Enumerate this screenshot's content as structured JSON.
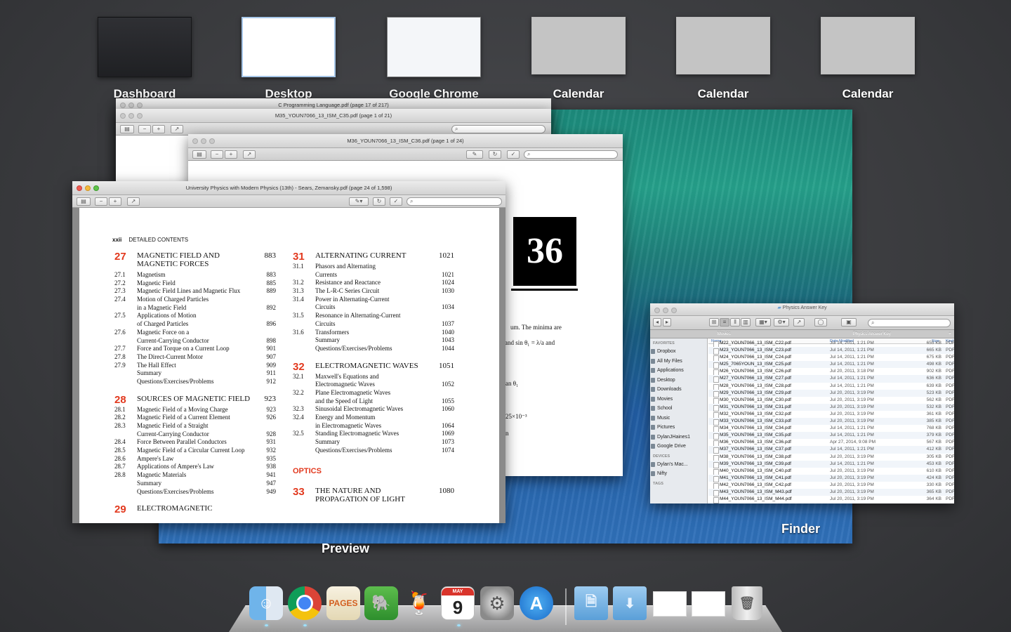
{
  "spaces": [
    {
      "label": "Dashboard"
    },
    {
      "label": "Desktop"
    },
    {
      "label": "Google Chrome"
    },
    {
      "label": "Calendar"
    },
    {
      "label": "Calendar"
    },
    {
      "label": "Calendar"
    }
  ],
  "preview": {
    "app_label": "Preview",
    "windows": {
      "cprog_title": "C Programming Language.pdf (page 17 of 217)",
      "m35_title": "M35_YOUN7066_13_ISM_C35.pdf (page 1 of 21)",
      "m36_title": "M36_YOUN7066_13_ISM_C36.pdf (page 1 of 24)",
      "physics_title": "University Physics with Modern Physics (13th) - Sears, Zemansky.pdf (page 24 of 1,598)"
    },
    "m36_page": {
      "chapter_number": "36",
      "fragments": [
        "um. The minima are",
        "and  sin θ₁ = λ/a  and",
        "an θ₁",
        "25×10⁻³",
        "n"
      ]
    },
    "page": {
      "page_num": "xxii",
      "header": "DETAILED CONTENTS",
      "left_column": [
        {
          "num": "27",
          "title": "MAGNETIC FIELD AND MAGNETIC FORCES",
          "page": "883",
          "sections": [
            {
              "num": "27.1",
              "title": "Magnetism",
              "page": "883"
            },
            {
              "num": "27.2",
              "title": "Magnetic Field",
              "page": "885"
            },
            {
              "num": "27.3",
              "title": "Magnetic Field Lines and Magnetic Flux",
              "page": "889"
            },
            {
              "num": "27.4",
              "title": "Motion of Charged Particles",
              "page": ""
            },
            {
              "num": "",
              "title": "in a Magnetic Field",
              "page": "892"
            },
            {
              "num": "27.5",
              "title": "Applications of Motion",
              "page": ""
            },
            {
              "num": "",
              "title": "of Charged Particles",
              "page": "896"
            },
            {
              "num": "27.6",
              "title": "Magnetic Force on a",
              "page": ""
            },
            {
              "num": "",
              "title": "Current-Carrying Conductor",
              "page": "898"
            },
            {
              "num": "27.7",
              "title": "Force and Torque on a Current Loop",
              "page": "901"
            },
            {
              "num": "27.8",
              "title": "The Direct-Current Motor",
              "page": "907"
            },
            {
              "num": "27.9",
              "title": "The Hall Effect",
              "page": "909"
            },
            {
              "num": "",
              "title": "Summary",
              "page": "911"
            },
            {
              "num": "",
              "title": "Questions/Exercises/Problems",
              "page": "912"
            }
          ]
        },
        {
          "num": "28",
          "title": "SOURCES OF MAGNETIC FIELD",
          "page": "923",
          "sections": [
            {
              "num": "28.1",
              "title": "Magnetic Field of a Moving Charge",
              "page": "923"
            },
            {
              "num": "28.2",
              "title": "Magnetic Field of a Current Element",
              "page": "926"
            },
            {
              "num": "28.3",
              "title": "Magnetic Field of a Straight",
              "page": ""
            },
            {
              "num": "",
              "title": "Current-Carrying Conductor",
              "page": "928"
            },
            {
              "num": "28.4",
              "title": "Force Between Parallel Conductors",
              "page": "931"
            },
            {
              "num": "28.5",
              "title": "Magnetic Field of a Circular Current Loop",
              "page": "932"
            },
            {
              "num": "28.6",
              "title": "Ampere's Law",
              "page": "935"
            },
            {
              "num": "28.7",
              "title": "Applications of Ampere's Law",
              "page": "938"
            },
            {
              "num": "28.8",
              "title": "Magnetic Materials",
              "page": "941"
            },
            {
              "num": "",
              "title": "Summary",
              "page": "947"
            },
            {
              "num": "",
              "title": "Questions/Exercises/Problems",
              "page": "949"
            }
          ]
        },
        {
          "num": "29",
          "title": "ELECTROMAGNETIC",
          "page": "",
          "sections": []
        }
      ],
      "right_column": [
        {
          "num": "31",
          "title": "ALTERNATING CURRENT",
          "page": "1021",
          "sections": [
            {
              "num": "31.1",
              "title": "Phasors and Alternating",
              "page": ""
            },
            {
              "num": "",
              "title": "Currents",
              "page": "1021"
            },
            {
              "num": "31.2",
              "title": "Resistance and Reactance",
              "page": "1024"
            },
            {
              "num": "31.3",
              "title": "The L-R-C Series Circuit",
              "page": "1030"
            },
            {
              "num": "31.4",
              "title": "Power in Alternating-Current",
              "page": ""
            },
            {
              "num": "",
              "title": "Circuits",
              "page": "1034"
            },
            {
              "num": "31.5",
              "title": "Resonance in Alternating-Current",
              "page": ""
            },
            {
              "num": "",
              "title": "Circuits",
              "page": "1037"
            },
            {
              "num": "31.6",
              "title": "Transformers",
              "page": "1040"
            },
            {
              "num": "",
              "title": "Summary",
              "page": "1043"
            },
            {
              "num": "",
              "title": "Questions/Exercises/Problems",
              "page": "1044"
            }
          ]
        },
        {
          "num": "32",
          "title": "ELECTROMAGNETIC WAVES",
          "page": "1051",
          "sections": [
            {
              "num": "32.1",
              "title": "Maxwell's Equations and",
              "page": ""
            },
            {
              "num": "",
              "title": "Electromagnetic Waves",
              "page": "1052"
            },
            {
              "num": "32.2",
              "title": "Plane Electromagnetic Waves",
              "page": ""
            },
            {
              "num": "",
              "title": "and the Speed of Light",
              "page": "1055"
            },
            {
              "num": "32.3",
              "title": "Sinusoidal Electromagnetic Waves",
              "page": "1060"
            },
            {
              "num": "32.4",
              "title": "Energy and Momentum",
              "page": ""
            },
            {
              "num": "",
              "title": "in Electromagnetic Waves",
              "page": "1064"
            },
            {
              "num": "32.5",
              "title": "Standing Electromagnetic Waves",
              "page": "1069"
            },
            {
              "num": "",
              "title": "Summary",
              "page": "1073"
            },
            {
              "num": "",
              "title": "Questions/Exercises/Problems",
              "page": "1074"
            }
          ]
        }
      ],
      "optics_label": "OPTICS",
      "chapter_33": {
        "num": "33",
        "title": "THE NATURE AND PROPAGATION OF LIGHT",
        "page": "1080"
      }
    }
  },
  "finder": {
    "app_label": "Finder",
    "window_title": "Physics Answer Key",
    "tabs": [
      "Movies",
      "Physics Answer Key"
    ],
    "sidebar": {
      "favorites_heading": "FAVORITES",
      "favorites": [
        "Dropbox",
        "All My Files",
        "Applications",
        "Desktop",
        "Downloads",
        "Movies",
        "School",
        "Music",
        "Pictures",
        "DylanJHaines1",
        "Google Drive"
      ],
      "devices_heading": "DEVICES",
      "devices": [
        "Dylan's Mac...",
        "Nifty"
      ],
      "tags_heading": "TAGS"
    },
    "columns": {
      "name": "Name",
      "date": "Date Modified",
      "size": "Size",
      "kind": "Kind"
    },
    "files": [
      {
        "name": "M22_YOUN7066_13_ISM_C22.pdf",
        "date": "Jul 14, 2011, 1:21 PM",
        "size": "655 KB",
        "kind": "PDF Do"
      },
      {
        "name": "M23_YOUN7066_13_ISM_C23.pdf",
        "date": "Jul 14, 2011, 1:21 PM",
        "size": "665 KB",
        "kind": "PDF Do"
      },
      {
        "name": "M24_YOUN7066_13_ISM_C24.pdf",
        "date": "Jul 14, 2011, 1:21 PM",
        "size": "675 KB",
        "kind": "PDF Do"
      },
      {
        "name": "M25_7065YOUN_13_ISM_C25.pdf",
        "date": "Jul 14, 2011, 1:21 PM",
        "size": "498 KB",
        "kind": "PDF Do"
      },
      {
        "name": "M26_YOUN7066_13_ISM_C26.pdf",
        "date": "Jul 20, 2011, 3:18 PM",
        "size": "902 KB",
        "kind": "PDF Do"
      },
      {
        "name": "M27_YOUN7066_13_ISM_C27.pdf",
        "date": "Jul 14, 2011, 1:21 PM",
        "size": "636 KB",
        "kind": "PDF Do"
      },
      {
        "name": "M28_YOUN7066_13_ISM_C28.pdf",
        "date": "Jul 14, 2011, 1:21 PM",
        "size": "639 KB",
        "kind": "PDF Do"
      },
      {
        "name": "M29_YOUN7066_13_ISM_C29.pdf",
        "date": "Jul 20, 2011, 3:19 PM",
        "size": "523 KB",
        "kind": "PDF Do"
      },
      {
        "name": "M30_YOUN7066_13_ISM_C30.pdf",
        "date": "Jul 20, 2011, 3:19 PM",
        "size": "562 KB",
        "kind": "PDF Do"
      },
      {
        "name": "M31_YOUN7066_13_ISM_C31.pdf",
        "date": "Jul 20, 2011, 3:19 PM",
        "size": "532 KB",
        "kind": "PDF Do"
      },
      {
        "name": "M32_YOUN7066_13_ISM_C32.pdf",
        "date": "Jul 20, 2011, 3:19 PM",
        "size": "361 KB",
        "kind": "PDF Do"
      },
      {
        "name": "M33_YOUN7066_13_ISM_C33.pdf",
        "date": "Jul 20, 2011, 3:19 PM",
        "size": "385 KB",
        "kind": "PDF Do"
      },
      {
        "name": "M34_YOUN7066_13_ISM_C34.pdf",
        "date": "Jul 14, 2011, 1:21 PM",
        "size": "768 KB",
        "kind": "PDF Do"
      },
      {
        "name": "M35_YOUN7066_13_ISM_C35.pdf",
        "date": "Jul 14, 2011, 1:21 PM",
        "size": "379 KB",
        "kind": "PDF Do"
      },
      {
        "name": "M36_YOUN7066_13_ISM_C36.pdf",
        "date": "Apr 27, 2014, 9:08 PM",
        "size": "567 KB",
        "kind": "PDF Do"
      },
      {
        "name": "M37_YOUN7066_13_ISM_C37.pdf",
        "date": "Jul 14, 2011, 1:21 PM",
        "size": "412 KB",
        "kind": "PDF Do"
      },
      {
        "name": "M38_YOUN7066_13_ISM_C38.pdf",
        "date": "Jul 20, 2011, 3:19 PM",
        "size": "305 KB",
        "kind": "PDF Do"
      },
      {
        "name": "M39_YOUN7066_13_ISM_C39.pdf",
        "date": "Jul 14, 2011, 1:21 PM",
        "size": "453 KB",
        "kind": "PDF Do"
      },
      {
        "name": "M40_YOUN7066_13_ISM_C40.pdf",
        "date": "Jul 20, 2011, 3:19 PM",
        "size": "610 KB",
        "kind": "PDF Do"
      },
      {
        "name": "M41_YOUN7066_13_ISM_C41.pdf",
        "date": "Jul 20, 2011, 3:19 PM",
        "size": "424 KB",
        "kind": "PDF Do"
      },
      {
        "name": "M42_YOUN7066_13_ISM_C42.pdf",
        "date": "Jul 20, 2011, 3:19 PM",
        "size": "330 KB",
        "kind": "PDF Do"
      },
      {
        "name": "M43_YOUN7066_13_ISM_M43.pdf",
        "date": "Jul 20, 2011, 3:19 PM",
        "size": "365 KB",
        "kind": "PDF Do"
      },
      {
        "name": "M44_YOUN7066_13_ISM_M44.pdf",
        "date": "Jul 20, 2011, 3:19 PM",
        "size": "364 KB",
        "kind": "PDF Do"
      }
    ]
  },
  "dock": {
    "items": [
      {
        "name": "finder-dock-icon",
        "glyph": "☺"
      },
      {
        "name": "chrome-dock-icon",
        "glyph": ""
      },
      {
        "name": "pages-dock-icon",
        "glyph": "PAGES"
      },
      {
        "name": "evernote-dock-icon",
        "glyph": "🐘"
      },
      {
        "name": "cocktail-dock-icon",
        "glyph": "🍹"
      },
      {
        "name": "calendar-dock-icon",
        "month": "MAY",
        "day": "9"
      },
      {
        "name": "system-preferences-dock-icon",
        "glyph": "⚙"
      },
      {
        "name": "app-store-dock-icon",
        "glyph": "A"
      },
      {
        "name": "documents-folder-dock-icon",
        "glyph": "🗎"
      },
      {
        "name": "downloads-folder-dock-icon",
        "glyph": "⬇"
      },
      {
        "name": "trash-dock-icon",
        "glyph": "🗑"
      }
    ]
  }
}
